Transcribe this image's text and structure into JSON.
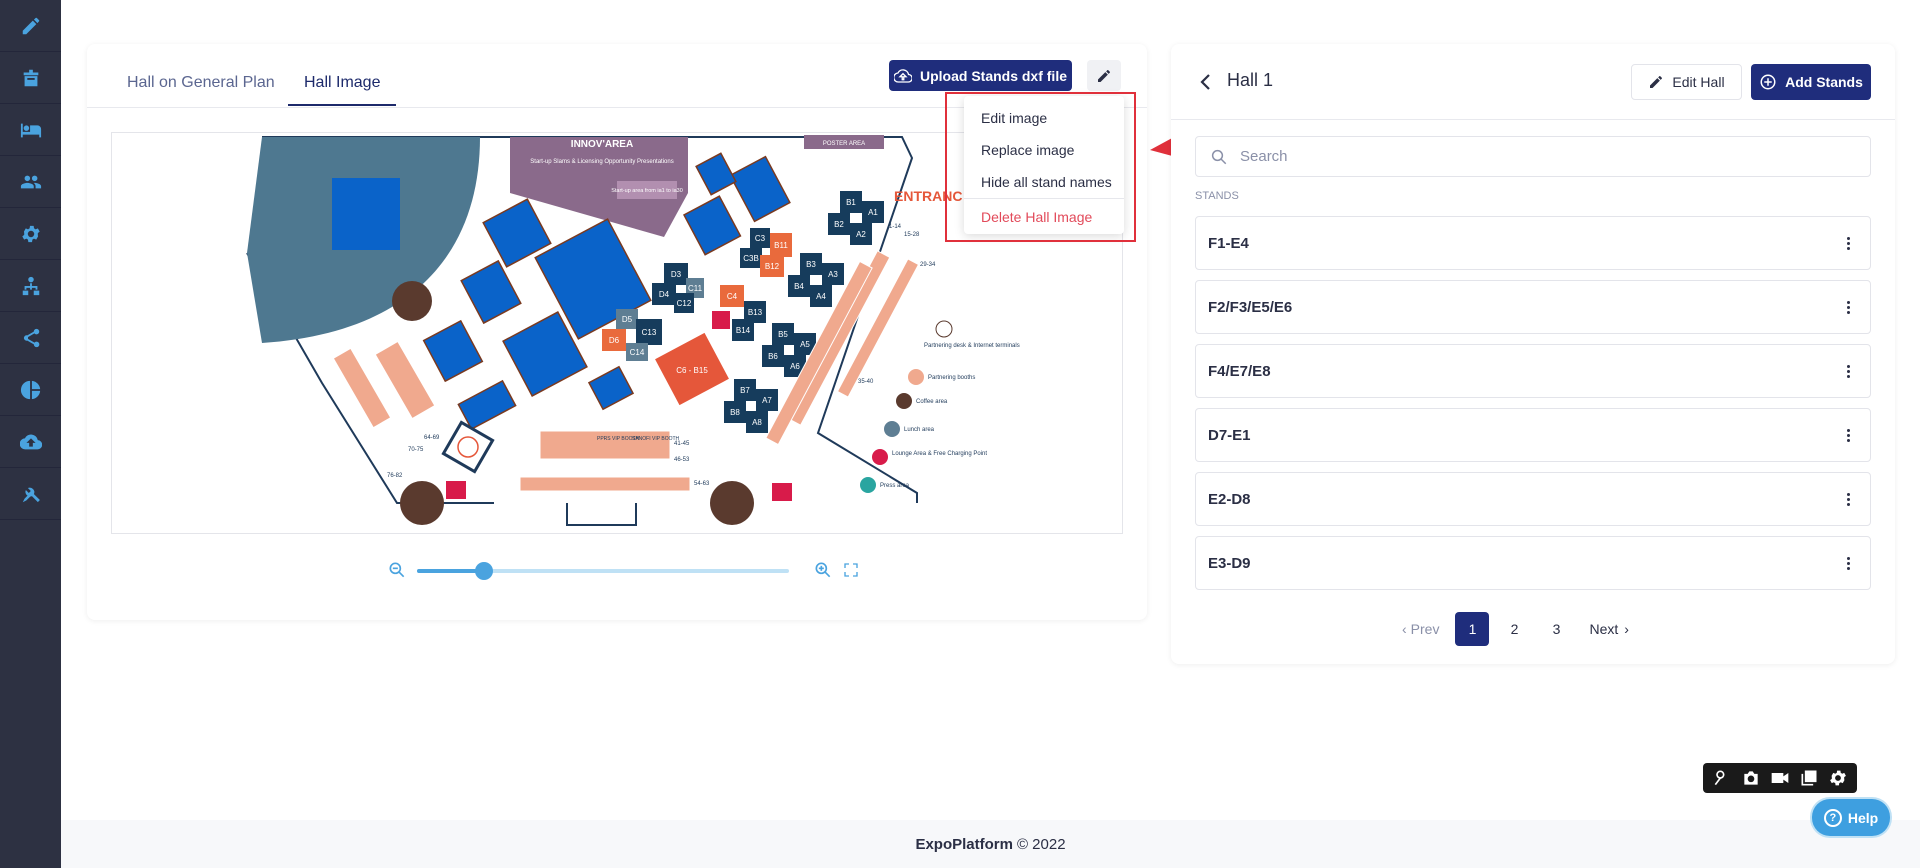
{
  "sidebar": {
    "items": [
      {
        "icon": "pencil-icon"
      },
      {
        "icon": "podium-icon"
      },
      {
        "icon": "bed-icon"
      },
      {
        "icon": "users-icon"
      },
      {
        "icon": "gear-icon"
      },
      {
        "icon": "org-chart-icon"
      },
      {
        "icon": "share-icon"
      },
      {
        "icon": "pie-chart-icon"
      },
      {
        "icon": "cloud-icon"
      },
      {
        "icon": "tools-icon"
      }
    ]
  },
  "left_panel": {
    "tabs": [
      {
        "label": "Hall on General Plan",
        "active": false
      },
      {
        "label": "Hall Image",
        "active": true
      }
    ],
    "upload_button": "Upload Stands dxf file",
    "zoom_level": 0.18,
    "floorplan": {
      "zone_title": "INNOV'AREA",
      "zone_sub": "Start-up Slams & Licensing Opportunity Presentations",
      "startup_area": "Start-up area from ia1 to ia30",
      "poster_area": "POSTER AREA",
      "entrance": "ENTRANC",
      "stands": [
        "B1",
        "A1",
        "B2",
        "A2",
        "C3",
        "B11",
        "C3B",
        "B12",
        "B3",
        "A3",
        "B4",
        "A4",
        "D3",
        "D4",
        "C11",
        "C12",
        "C4",
        "B13",
        "B14",
        "D5",
        "C13",
        "D6",
        "C14",
        "B5",
        "A5",
        "B6",
        "A6",
        "C6 - B15",
        "B7",
        "A7",
        "B8",
        "A8"
      ],
      "ranges": [
        "1-14",
        "15-28",
        "29-34",
        "35-40",
        "41-45",
        "46-53",
        "54-63",
        "64-69",
        "70-75",
        "76-82"
      ],
      "booths": [
        "PPRS VIP BOOTH",
        "SANOFI VIP BOOTH"
      ],
      "legend": [
        "Partnering desk & Internet terminals",
        "Partnering booths",
        "Coffee area",
        "Lunch area",
        "Lounge Area & Free Charging Point",
        "Press area"
      ]
    }
  },
  "dropdown": {
    "items": [
      "Edit image",
      "Replace image",
      "Hide all stand names"
    ],
    "danger_item": "Delete Hall Image"
  },
  "right_panel": {
    "title": "Hall 1",
    "edit_hall": "Edit Hall",
    "add_stands": "Add Stands",
    "search_placeholder": "Search",
    "stands_label": "STANDS",
    "stands": [
      "F1-E4",
      "F2/F3/E5/E6",
      "F4/E7/E8",
      "D7-E1",
      "E2-D8",
      "E3-D9"
    ],
    "pagination": {
      "prev": "Prev",
      "pages": [
        "1",
        "2",
        "3"
      ],
      "current": "1",
      "next": "Next"
    }
  },
  "footer": {
    "brand": "ExpoPlatform",
    "copyright": "© 2022"
  },
  "help_label": "Help",
  "colors": {
    "sidebar": "#2d3142",
    "primary": "#1f2d7c",
    "accent": "#4aa3df",
    "danger": "#e24a5a",
    "annotation": "#e0303b"
  }
}
